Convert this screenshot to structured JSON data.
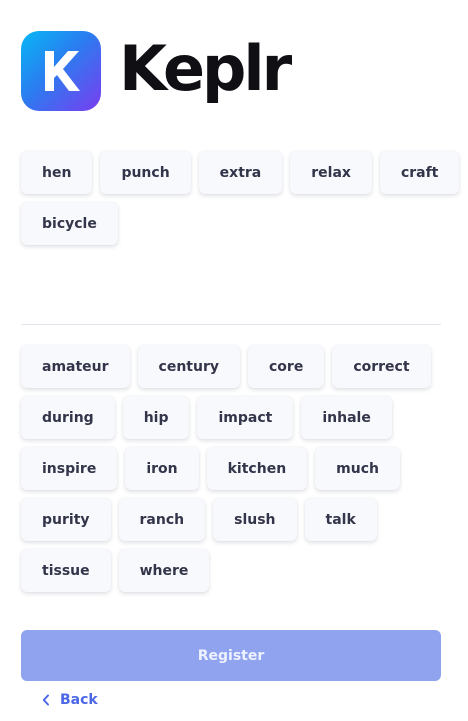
{
  "brand": {
    "name": "Keplr",
    "mark_letter": "K",
    "gradient_colors": [
      "#06b7f5",
      "#2b7cf0",
      "#7a3df0"
    ]
  },
  "selected_words": [
    [
      "hen",
      "punch",
      "extra",
      "relax",
      "craft"
    ],
    [
      "bicycle"
    ]
  ],
  "word_pool": [
    [
      "amateur",
      "century",
      "core",
      "correct"
    ],
    [
      "during",
      "hip",
      "impact",
      "inhale"
    ],
    [
      "inspire",
      "iron",
      "kitchen",
      "much"
    ],
    [
      "purity",
      "ranch",
      "slush",
      "talk"
    ],
    [
      "tissue",
      "where"
    ]
  ],
  "register_label": "Register",
  "back_label": "Back",
  "colors": {
    "register_bg": "#8fa3ee",
    "accent": "#4c67e6",
    "chip_bg": "#f8f9fc"
  },
  "icons": {
    "back": "chevron-left-icon"
  }
}
